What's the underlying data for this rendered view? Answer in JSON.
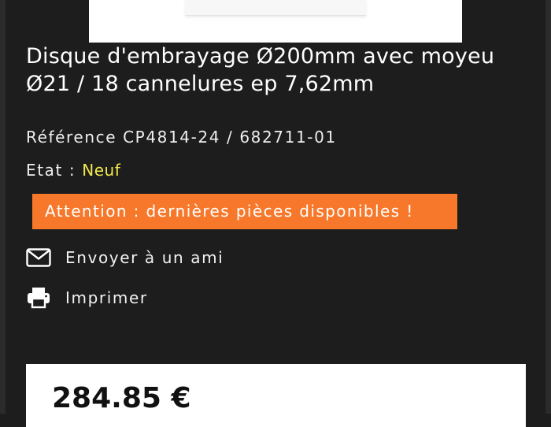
{
  "product": {
    "title_line1": "Disque d'embrayage Ø200mm avec moyeu",
    "title_line2": "Ø21 / 18 cannelures ep 7,62mm",
    "reference_label": "Référence",
    "reference_value": "CP4814-24 / 682711-01",
    "state_label": "Etat :",
    "state_value": "Neuf",
    "stock_alert": "Attention : dernières pièces disponibles !"
  },
  "actions": {
    "email_friend": {
      "label": "Envoyer à un ami",
      "icon": "envelope-icon"
    },
    "print": {
      "label": "Imprimer",
      "icon": "printer-icon"
    }
  },
  "price": {
    "amount": "284.85 €"
  },
  "colors": {
    "background": "#1d1d1d",
    "state_value": "#f2e84a",
    "alert_background": "#f7782a",
    "text": "#ffffff"
  }
}
